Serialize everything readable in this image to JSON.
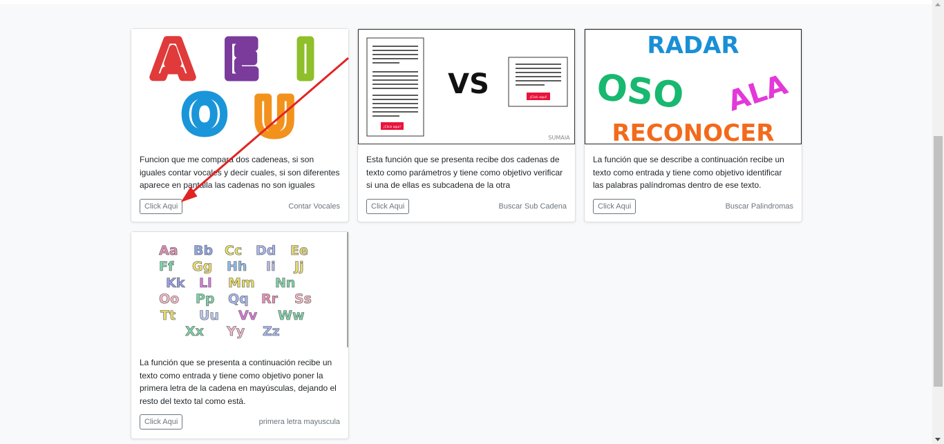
{
  "cards": [
    {
      "image_letters": [
        "A",
        "E",
        "I",
        "O",
        "U"
      ],
      "description": "Funcion que me compara dos cadeneas, si son iguales contar vocales y decir cuales, si son diferentes aparece en pantalla las cadenas no son iguales",
      "button_label": "Click Aqui",
      "footer": "Contar Vocales"
    },
    {
      "image_vs": "VS",
      "image_button_text": "¡Click aquí!",
      "image_watermark": "SUMAIA",
      "description": "Esta función que se presenta recibe dos cadenas de texto como parámetros y tiene como objetivo verificar si una de ellas es subcadena de la otra",
      "button_label": "Click Aqui",
      "footer": "Buscar Sub Cadena"
    },
    {
      "image_words": [
        "RADAR",
        "OSO",
        "ALA",
        "RECONOCER"
      ],
      "description": "La función que se describe a continuación recibe un texto como entrada y tiene como objetivo identificar las palabras palíndromas dentro de ese texto.",
      "button_label": "Click Aqui",
      "footer": "Buscar Palindromas"
    },
    {
      "image_rows": [
        [
          "Aa",
          "Bb",
          "Cc",
          "Dd",
          "Ee"
        ],
        [
          "Ff",
          "Gg",
          "Hh",
          "Ii",
          "Jj"
        ],
        [
          "Kk",
          "Ll",
          "Mm",
          "Nn"
        ],
        [
          "Oo",
          "Pp",
          "Qq",
          "Rr",
          "Ss"
        ],
        [
          "Tt",
          "Uu",
          "Vv",
          "Ww"
        ],
        [
          "Xx",
          "Yy",
          "Zz"
        ]
      ],
      "description": "La función que se presenta a continuación recibe un texto como entrada y tiene como objetivo poner la primera letra de la cadena en mayúsculas, dejando el resto del texto tal como está.",
      "button_label": "Click Aqui",
      "footer": "primera letra mayuscula"
    }
  ],
  "colors": {
    "page_bg": "#f8f9fa",
    "annotation_arrow": "#e02424",
    "button_border": "#6c757d"
  }
}
